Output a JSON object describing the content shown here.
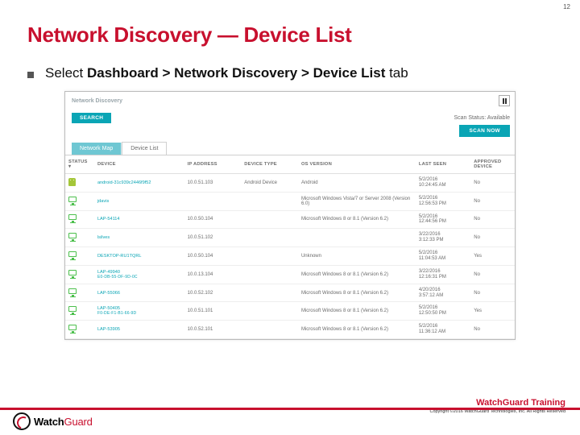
{
  "page_number": "12",
  "title": "Network Discovery — Device List",
  "bullet_prefix": "Select ",
  "bullet_bold": "Dashboard > Network Discovery > Device List",
  "bullet_suffix": " tab",
  "ui": {
    "breadcrumb": "Network Discovery",
    "scan_status": "Scan Status: Available",
    "search_btn": "SEARCH",
    "scan_btn": "SCAN NOW",
    "tabs": {
      "map": "Network Map",
      "list": "Device List"
    },
    "headers": {
      "status": "STATUS",
      "device": "DEVICE",
      "ip": "IP ADDRESS",
      "type": "DEVICE TYPE",
      "os": "OS VERSION",
      "seen": "LAST SEEN",
      "approved": "APPROVED DEVICE"
    },
    "rows": [
      {
        "icon": "android",
        "device": "android-31c939c2446f9f52",
        "mac": "",
        "ip": "10.0.51.103",
        "type": "Android Device",
        "os": "Android",
        "seen1": "5/2/2016",
        "seen2": "10:24:45 AM",
        "approved": "No"
      },
      {
        "icon": "monitor",
        "device": "jdavis",
        "mac": "",
        "ip": "",
        "type": "",
        "os": "Microsoft Windows Vista/7 or Server 2008 (Version 6.0)",
        "seen1": "5/2/2016",
        "seen2": "12:56:53 PM",
        "approved": "No"
      },
      {
        "icon": "monitor",
        "device": "LAP-54114",
        "mac": "",
        "ip": "10.0.50.104",
        "type": "",
        "os": "Microsoft Windows 8 or 8.1 (Version 6.2)",
        "seen1": "5/2/2016",
        "seen2": "12:44:56 PM",
        "approved": "No"
      },
      {
        "icon": "monitor",
        "device": "lsilves",
        "mac": "",
        "ip": "10.0.51.102",
        "type": "",
        "os": "",
        "seen1": "3/22/2016",
        "seen2": "3:12:33 PM",
        "approved": "No"
      },
      {
        "icon": "monitor",
        "device": "DESKTOP-RU1TQRL",
        "mac": "",
        "ip": "10.0.50.104",
        "type": "",
        "os": "Unknown",
        "seen1": "5/2/2016",
        "seen2": "11:04:53 AM",
        "approved": "Yes"
      },
      {
        "icon": "monitor",
        "device": "LAP-49940",
        "mac": "E0-DB-55-DF-9D-0C",
        "ip": "10.0.13.104",
        "type": "",
        "os": "Microsoft Windows 8 or 8.1 (Version 6.2)",
        "seen1": "3/22/2016",
        "seen2": "12:16:31 PM",
        "approved": "No"
      },
      {
        "icon": "monitor",
        "device": "LAP-55066",
        "mac": "",
        "ip": "10.0.52.102",
        "type": "",
        "os": "Microsoft Windows 8 or 8.1 (Version 6.2)",
        "seen1": "4/20/2016",
        "seen2": "3:57:12 AM",
        "approved": "No"
      },
      {
        "icon": "monitor",
        "device": "LAP-50405",
        "mac": "F0-DE-F1-B1-66-9D",
        "ip": "10.0.51.101",
        "type": "",
        "os": "Microsoft Windows 8 or 8.1 (Version 6.2)",
        "seen1": "5/2/2016",
        "seen2": "12:50:50 PM",
        "approved": "Yes"
      },
      {
        "icon": "monitor",
        "device": "LAP-53905",
        "mac": "",
        "ip": "10.0.52.101",
        "type": "",
        "os": "Microsoft Windows 8 or 8.1 (Version 6.2)",
        "seen1": "5/2/2016",
        "seen2": "11:36:12 AM",
        "approved": "No"
      }
    ]
  },
  "footer": {
    "logo_black": "Watch",
    "logo_red": "Guard",
    "training": "WatchGuard Training",
    "copyright": "Copyright ©2016 WatchGuard Technologies, Inc. All Rights Reserved"
  }
}
